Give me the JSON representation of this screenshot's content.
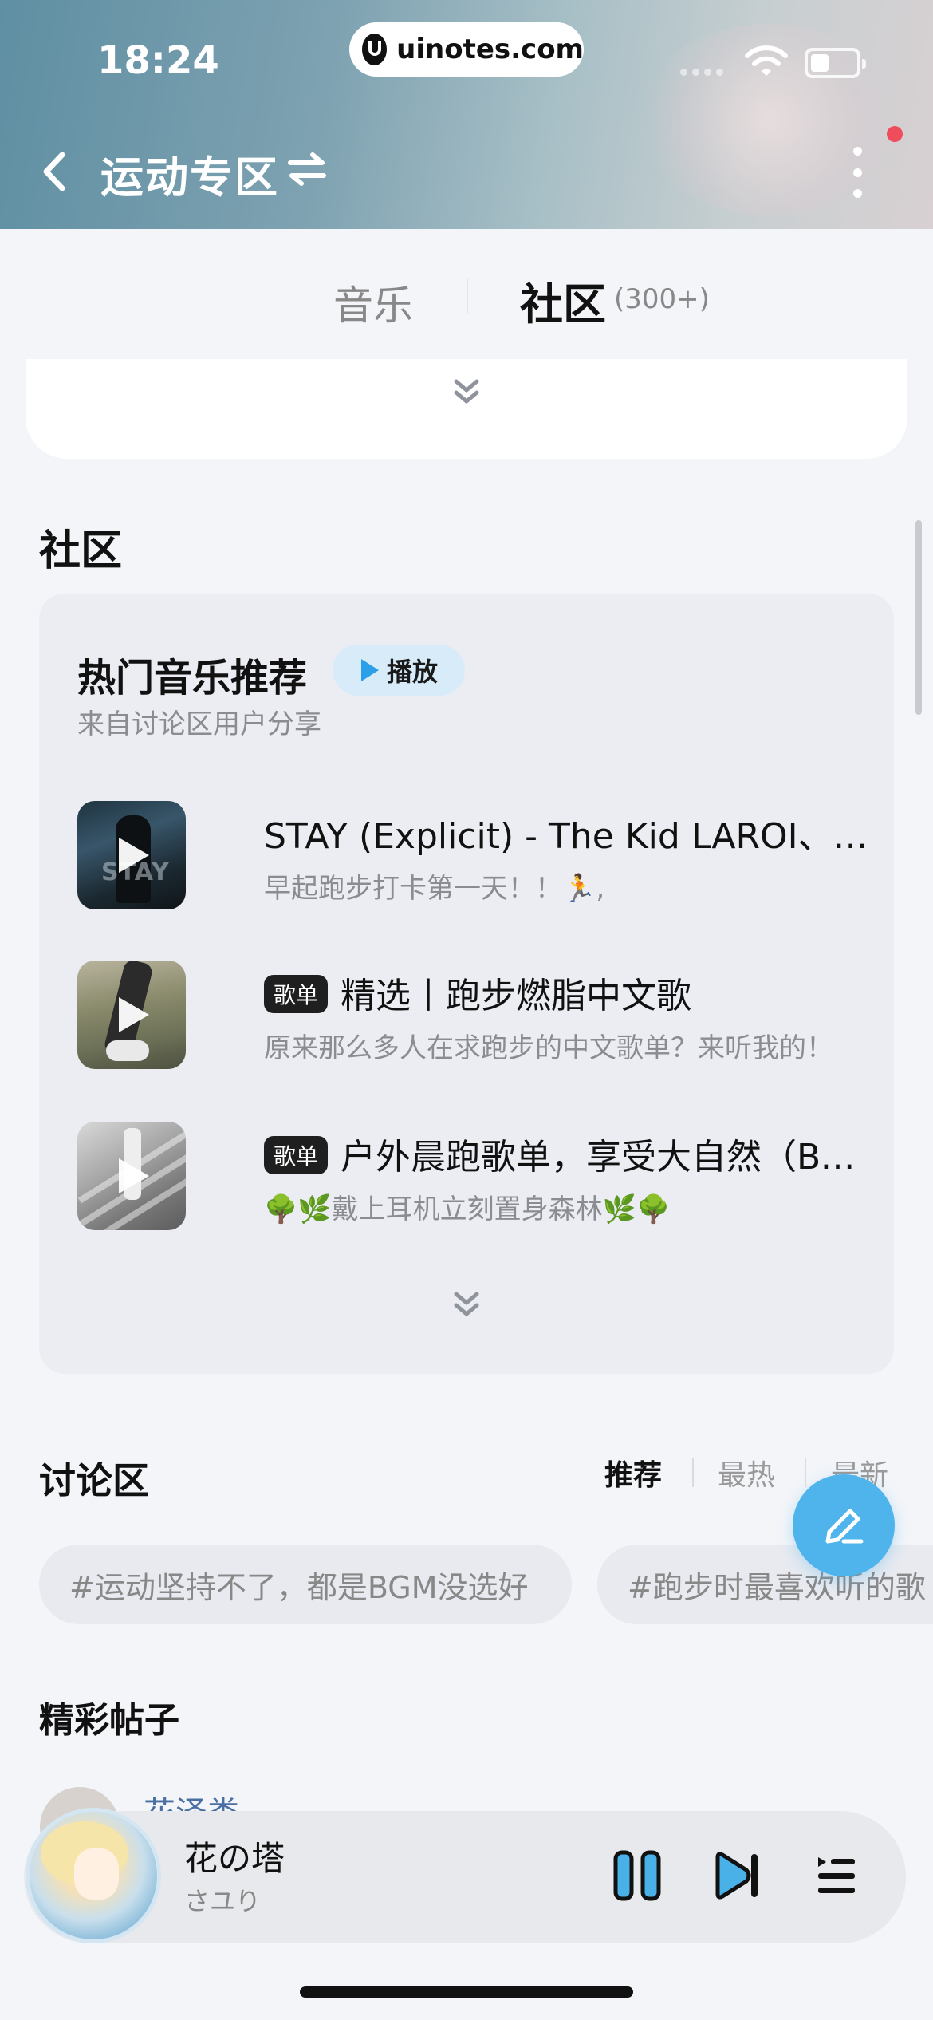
{
  "status_bar": {
    "time": "18:24",
    "url": "uinotes.com"
  },
  "header": {
    "title": "运动专区"
  },
  "tabs": {
    "music": "音乐",
    "community": "社区",
    "community_count": "(300+)"
  },
  "community_section": {
    "title": "社区"
  },
  "hot_music": {
    "title": "热门音乐推荐",
    "play_label": "播放",
    "subtitle": "来自讨论区用户分享",
    "items": [
      {
        "title": "STAY (Explicit) - The Kid LAROI、Justin Bieber",
        "subtitle": "早起跑步打卡第一天！！🏃,",
        "badge": "",
        "cover_text": "STAY"
      },
      {
        "title": "精选丨跑步燃脂中文歌",
        "subtitle": "原来那么多人在求跑步的中文歌单？来听我的！",
        "badge": "歌单"
      },
      {
        "title": "户外晨跑歌单，享受大自然（BGM）",
        "subtitle": "🌳🌿戴上耳机立刻置身森林🌿🌳",
        "badge": "歌单"
      }
    ]
  },
  "discussion": {
    "title": "讨论区",
    "sort_tabs": [
      "推荐",
      "最热",
      "最新"
    ],
    "topics": [
      "#运动坚持不了，都是BGM没选好",
      "#跑步时最喜欢听的歌"
    ]
  },
  "posts": {
    "title": "精彩帖子",
    "first_author": "花泽类"
  },
  "player": {
    "song": "花の塔",
    "artist": "さユり"
  },
  "colors": {
    "accent": "#4fb4ec",
    "play_pill_bg": "#d7ebf8",
    "notification": "#ef4d5c"
  }
}
